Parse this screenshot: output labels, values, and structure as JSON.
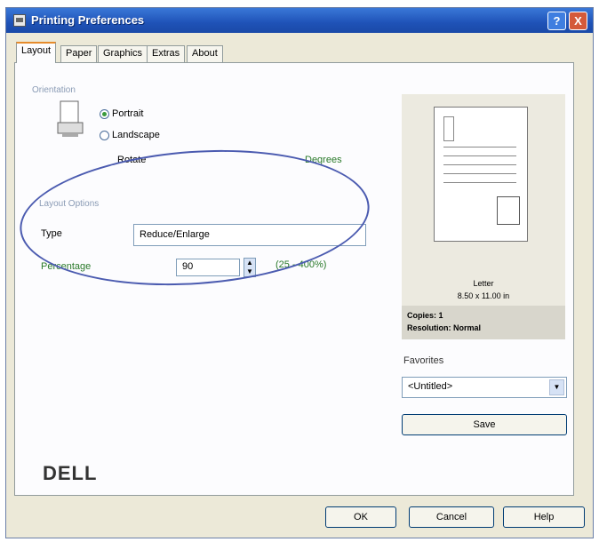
{
  "window": {
    "title": "Printing Preferences"
  },
  "tabs": [
    {
      "label": "Layout"
    },
    {
      "label": "Paper"
    },
    {
      "label": "Graphics"
    },
    {
      "label": "Extras"
    },
    {
      "label": "About"
    }
  ],
  "orientation": {
    "group_label": "Orientation",
    "portrait_label": "Portrait",
    "landscape_label": "Landscape",
    "rotate_label": "Rotate",
    "degrees_label": "Degrees"
  },
  "layout_options": {
    "group_label": "Layout Options",
    "type_label": "Type",
    "type_value": "Reduce/Enlarge",
    "percentage_label": "Percentage",
    "percentage_value": "90",
    "percentage_range": "(25 - 400%)"
  },
  "preview": {
    "paper_name": "Letter",
    "paper_size": "8.50 x 11.00 in",
    "copies": "Copies: 1",
    "resolution": "Resolution: Normal"
  },
  "favorites": {
    "label": "Favorites",
    "selected": "<Untitled>",
    "save_label": "Save"
  },
  "logo": {
    "text": "DELL"
  },
  "buttons": {
    "ok": "OK",
    "cancel": "Cancel",
    "help": "Help"
  },
  "title_buttons": {
    "help": "?",
    "close": "X"
  },
  "annotation": {
    "color": "#4b5bb0"
  }
}
